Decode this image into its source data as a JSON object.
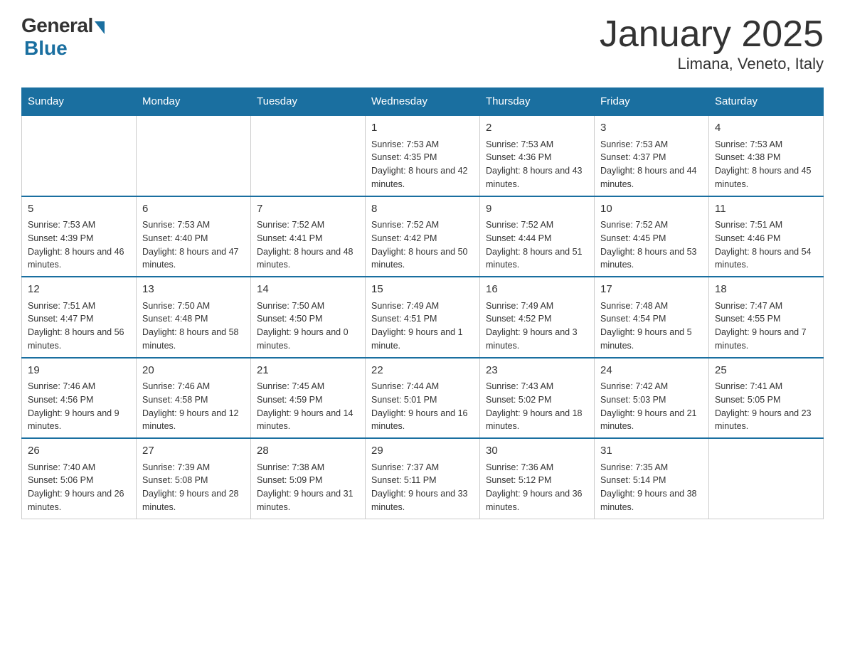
{
  "logo": {
    "general": "General",
    "blue": "Blue"
  },
  "title": "January 2025",
  "subtitle": "Limana, Veneto, Italy",
  "days_of_week": [
    "Sunday",
    "Monday",
    "Tuesday",
    "Wednesday",
    "Thursday",
    "Friday",
    "Saturday"
  ],
  "weeks": [
    [
      null,
      null,
      null,
      {
        "day": "1",
        "sunrise": "7:53 AM",
        "sunset": "4:35 PM",
        "daylight": "8 hours and 42 minutes."
      },
      {
        "day": "2",
        "sunrise": "7:53 AM",
        "sunset": "4:36 PM",
        "daylight": "8 hours and 43 minutes."
      },
      {
        "day": "3",
        "sunrise": "7:53 AM",
        "sunset": "4:37 PM",
        "daylight": "8 hours and 44 minutes."
      },
      {
        "day": "4",
        "sunrise": "7:53 AM",
        "sunset": "4:38 PM",
        "daylight": "8 hours and 45 minutes."
      }
    ],
    [
      {
        "day": "5",
        "sunrise": "7:53 AM",
        "sunset": "4:39 PM",
        "daylight": "8 hours and 46 minutes."
      },
      {
        "day": "6",
        "sunrise": "7:53 AM",
        "sunset": "4:40 PM",
        "daylight": "8 hours and 47 minutes."
      },
      {
        "day": "7",
        "sunrise": "7:52 AM",
        "sunset": "4:41 PM",
        "daylight": "8 hours and 48 minutes."
      },
      {
        "day": "8",
        "sunrise": "7:52 AM",
        "sunset": "4:42 PM",
        "daylight": "8 hours and 50 minutes."
      },
      {
        "day": "9",
        "sunrise": "7:52 AM",
        "sunset": "4:44 PM",
        "daylight": "8 hours and 51 minutes."
      },
      {
        "day": "10",
        "sunrise": "7:52 AM",
        "sunset": "4:45 PM",
        "daylight": "8 hours and 53 minutes."
      },
      {
        "day": "11",
        "sunrise": "7:51 AM",
        "sunset": "4:46 PM",
        "daylight": "8 hours and 54 minutes."
      }
    ],
    [
      {
        "day": "12",
        "sunrise": "7:51 AM",
        "sunset": "4:47 PM",
        "daylight": "8 hours and 56 minutes."
      },
      {
        "day": "13",
        "sunrise": "7:50 AM",
        "sunset": "4:48 PM",
        "daylight": "8 hours and 58 minutes."
      },
      {
        "day": "14",
        "sunrise": "7:50 AM",
        "sunset": "4:50 PM",
        "daylight": "9 hours and 0 minutes."
      },
      {
        "day": "15",
        "sunrise": "7:49 AM",
        "sunset": "4:51 PM",
        "daylight": "9 hours and 1 minute."
      },
      {
        "day": "16",
        "sunrise": "7:49 AM",
        "sunset": "4:52 PM",
        "daylight": "9 hours and 3 minutes."
      },
      {
        "day": "17",
        "sunrise": "7:48 AM",
        "sunset": "4:54 PM",
        "daylight": "9 hours and 5 minutes."
      },
      {
        "day": "18",
        "sunrise": "7:47 AM",
        "sunset": "4:55 PM",
        "daylight": "9 hours and 7 minutes."
      }
    ],
    [
      {
        "day": "19",
        "sunrise": "7:46 AM",
        "sunset": "4:56 PM",
        "daylight": "9 hours and 9 minutes."
      },
      {
        "day": "20",
        "sunrise": "7:46 AM",
        "sunset": "4:58 PM",
        "daylight": "9 hours and 12 minutes."
      },
      {
        "day": "21",
        "sunrise": "7:45 AM",
        "sunset": "4:59 PM",
        "daylight": "9 hours and 14 minutes."
      },
      {
        "day": "22",
        "sunrise": "7:44 AM",
        "sunset": "5:01 PM",
        "daylight": "9 hours and 16 minutes."
      },
      {
        "day": "23",
        "sunrise": "7:43 AM",
        "sunset": "5:02 PM",
        "daylight": "9 hours and 18 minutes."
      },
      {
        "day": "24",
        "sunrise": "7:42 AM",
        "sunset": "5:03 PM",
        "daylight": "9 hours and 21 minutes."
      },
      {
        "day": "25",
        "sunrise": "7:41 AM",
        "sunset": "5:05 PM",
        "daylight": "9 hours and 23 minutes."
      }
    ],
    [
      {
        "day": "26",
        "sunrise": "7:40 AM",
        "sunset": "5:06 PM",
        "daylight": "9 hours and 26 minutes."
      },
      {
        "day": "27",
        "sunrise": "7:39 AM",
        "sunset": "5:08 PM",
        "daylight": "9 hours and 28 minutes."
      },
      {
        "day": "28",
        "sunrise": "7:38 AM",
        "sunset": "5:09 PM",
        "daylight": "9 hours and 31 minutes."
      },
      {
        "day": "29",
        "sunrise": "7:37 AM",
        "sunset": "5:11 PM",
        "daylight": "9 hours and 33 minutes."
      },
      {
        "day": "30",
        "sunrise": "7:36 AM",
        "sunset": "5:12 PM",
        "daylight": "9 hours and 36 minutes."
      },
      {
        "day": "31",
        "sunrise": "7:35 AM",
        "sunset": "5:14 PM",
        "daylight": "9 hours and 38 minutes."
      },
      null
    ]
  ],
  "labels": {
    "sunrise_prefix": "Sunrise: ",
    "sunset_prefix": "Sunset: ",
    "daylight_prefix": "Daylight: "
  }
}
